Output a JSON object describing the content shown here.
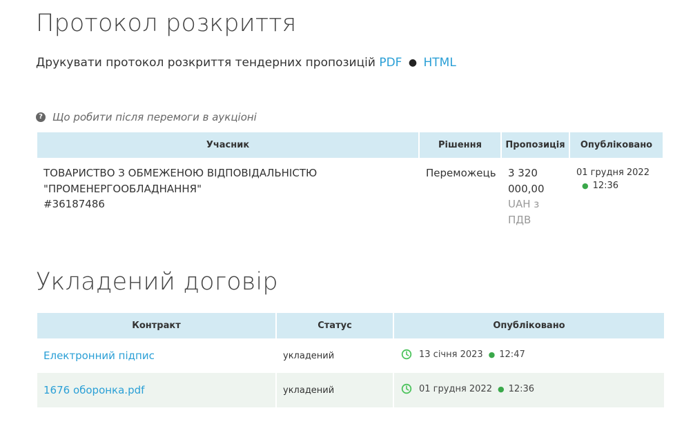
{
  "protocol": {
    "title": "Протокол розкриття",
    "print_text": "Друкувати протокол розкриття тендерних пропозицій",
    "link_pdf": "PDF",
    "separator": "●",
    "link_html": "HTML",
    "help_text": "Що робити після перемоги в аукціоні"
  },
  "bids_table": {
    "headers": [
      "Учасник",
      "Рішення",
      "Пропозиція",
      "Опубліковано"
    ],
    "rows": [
      {
        "participant_line1": "ТОВАРИСТВО З ОБМЕЖЕНОЮ ВІДПОВІДАЛЬНІСТЮ",
        "participant_line2": "\"ПРОМЕНЕРГООБЛАДНАННЯ\"",
        "participant_code": "#36187486",
        "decision": "Переможець",
        "offer_line1": "3 320",
        "offer_line2": "000,00",
        "offer_line3": "UAH з",
        "offer_line4": "ПДВ",
        "published_date": "01 грудня 2022",
        "published_time": "12:36"
      }
    ]
  },
  "contract": {
    "title": "Укладений договір",
    "headers": [
      "Контракт",
      "Статус",
      "Опубліковано"
    ],
    "rows": [
      {
        "name": "Електронний підпис",
        "status": "укладений",
        "date": "13 січня 2023",
        "time": "12:47"
      },
      {
        "name": "1676 оборонка.pdf",
        "status": "укладений",
        "date": "01 грудня 2022",
        "time": "12:36"
      }
    ]
  },
  "colors": {
    "link": "#2a9fd6",
    "header_bg": "#d3eaf3",
    "alt_row_bg": "#eef4ef",
    "accent_green": "#3aa84a"
  }
}
